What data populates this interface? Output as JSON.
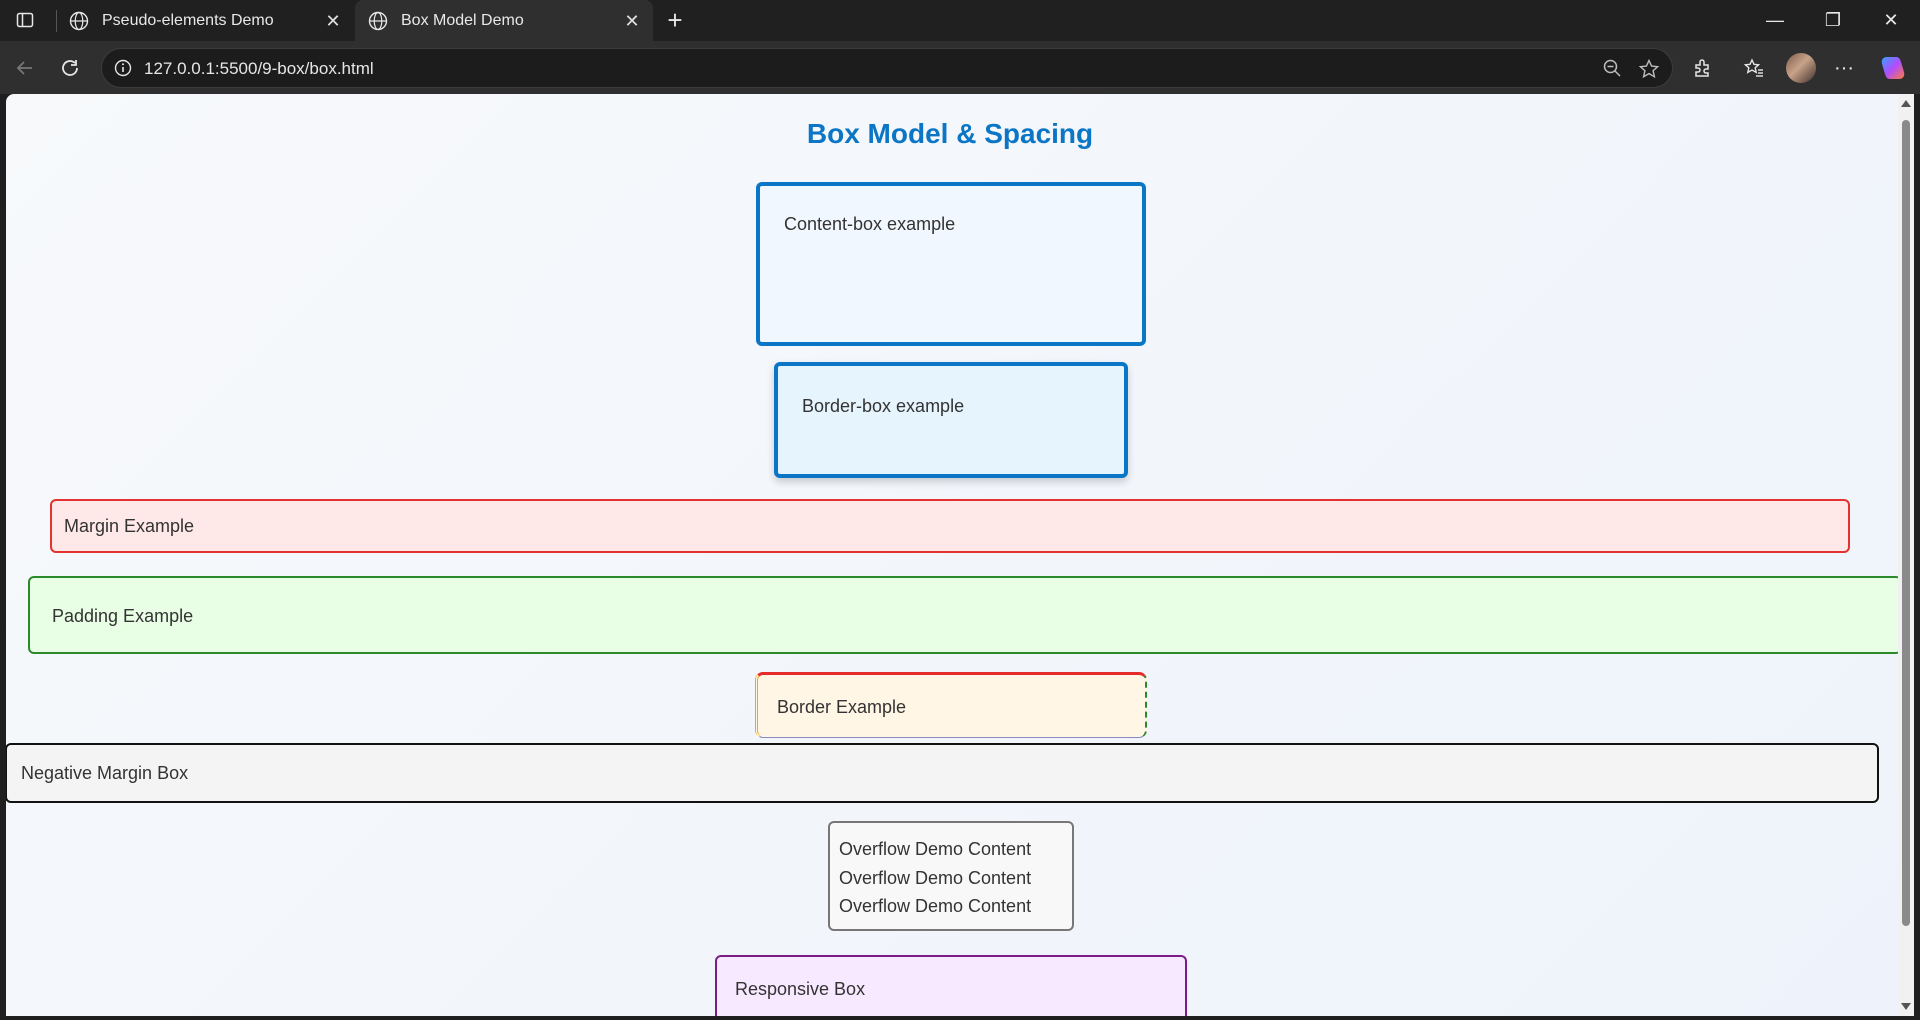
{
  "browser": {
    "tabs": [
      {
        "title": "Pseudo-elements Demo",
        "active": false
      },
      {
        "title": "Box Model Demo",
        "active": true
      }
    ],
    "tab_close_glyph": "✕",
    "new_tab_glyph": "+",
    "url": "127.0.0.1:5500/9-box/box.html",
    "window_controls": {
      "minimize": "—",
      "restore": "❐",
      "close": "✕"
    },
    "more_glyph": "···"
  },
  "page": {
    "title": "Box Model & Spacing",
    "content_box": "Content-box example",
    "border_box": "Border-box example",
    "margin_example": "Margin Example",
    "padding_example": "Padding Example",
    "border_example": "Border Example",
    "negative_margin": "Negative Margin Box",
    "overflow_lines": [
      "Overflow Demo Content",
      "Overflow Demo Content",
      "Overflow Demo Content"
    ],
    "responsive_box": "Responsive Box"
  },
  "colors": {
    "title": "#0b76c5",
    "content_border": "#0b76c5",
    "margin_border": "#e23232",
    "padding_border": "#2c8a2c",
    "responsive_border": "#7a1d85"
  },
  "icons": [
    "sidebar-icon",
    "globe-icon",
    "back-icon",
    "reload-icon",
    "info-icon",
    "zoom-out-icon",
    "star-icon",
    "extensions-icon",
    "favorites-icon",
    "profile-avatar",
    "more-icon",
    "copilot-icon"
  ]
}
